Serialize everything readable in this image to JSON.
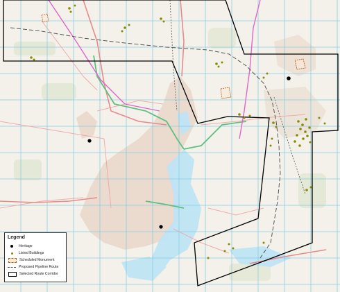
{
  "legend": {
    "title": "Legend",
    "items": [
      {
        "key": "heritage",
        "label": "Heritage",
        "color": "#000000"
      },
      {
        "key": "listed",
        "label": "Listed Buildings",
        "color": "#8a8a00"
      },
      {
        "key": "monument",
        "label": "Scheduled Monument",
        "color": "#b15a18"
      },
      {
        "key": "pipeline",
        "label": "Proposed Pipeline Route",
        "color": "#555555"
      },
      {
        "key": "corridor",
        "label": "Selected Route Corridor",
        "color": "#000000"
      }
    ]
  },
  "colors": {
    "background": "#f3f1ea",
    "gridline": "#74c9e2",
    "urban": "#ead8cc",
    "water": "#bfe4f5",
    "motorway": "#e066c8",
    "primary_road": "#5fbf82",
    "a_road": "#f2a3a3",
    "listed_building": "#8a8a00",
    "heritage": "#000000"
  }
}
